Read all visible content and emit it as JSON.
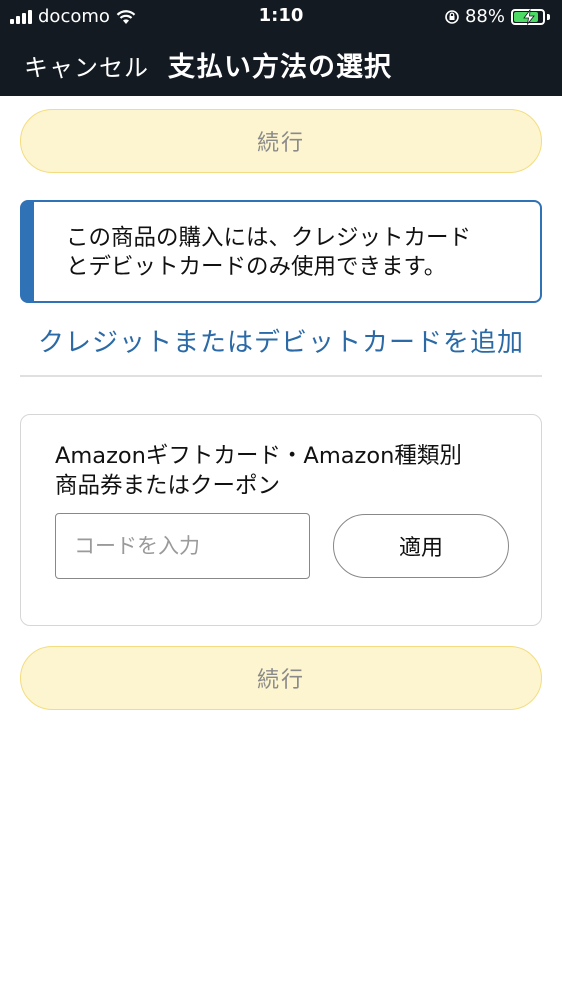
{
  "status_bar": {
    "carrier": "docomo",
    "time": "1:10",
    "battery_percent": "88%",
    "icons": [
      "signal-icon",
      "wifi-icon",
      "rotation-lock-icon",
      "battery-charging-icon"
    ],
    "battery_level": 0.88,
    "battery_color": "#4cd964"
  },
  "header": {
    "cancel_label": "キャンセル",
    "title": "支払い方法の選択",
    "background": "#131a22"
  },
  "buttons": {
    "continue_top": "続行",
    "continue_bottom": "続行",
    "continue_bg": "#fdf5cf"
  },
  "notice": {
    "line1": "この商品の購入には、クレジットカード",
    "line2": "とデビットカードのみ使用できます。",
    "accent": "#2f72b5"
  },
  "add_card_link": "クレジットまたはデビットカードを追加",
  "gift": {
    "label_line1": "Amazonギフトカード・Amazon種類別",
    "label_line2": "商品券またはクーポン",
    "code_placeholder": "コードを入力",
    "code_value": "",
    "apply_label": "適用"
  }
}
